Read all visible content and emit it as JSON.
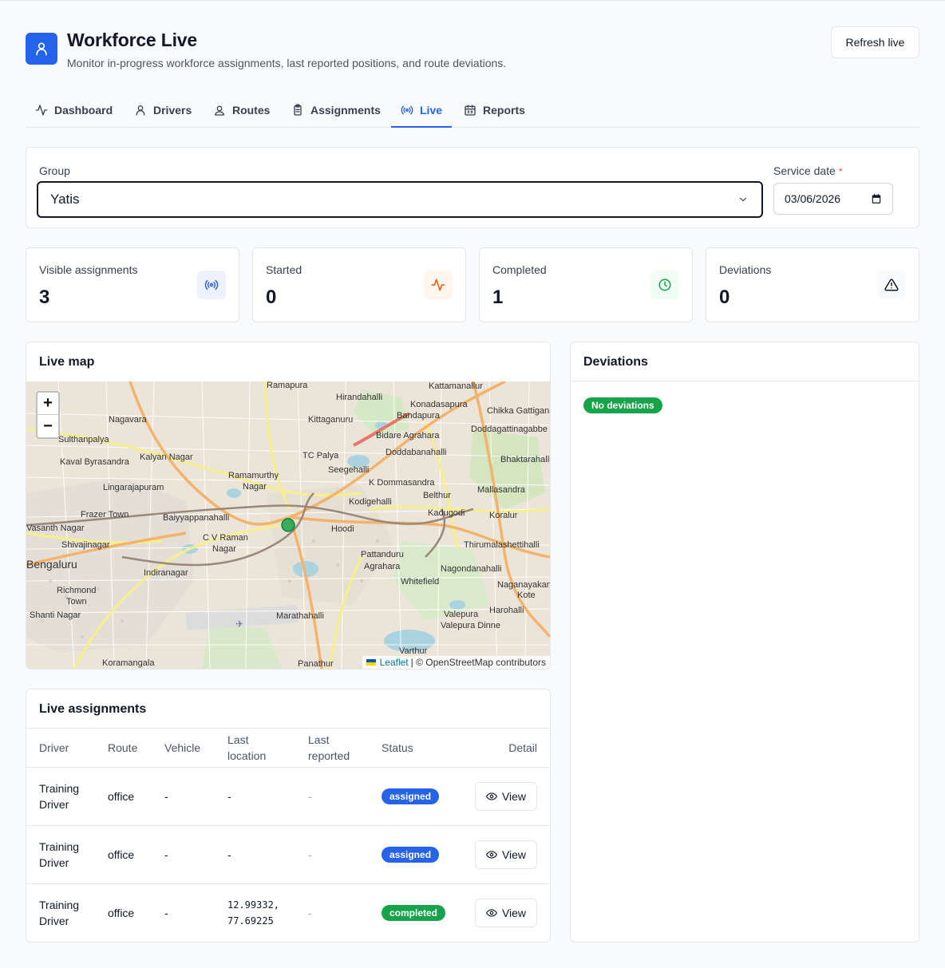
{
  "header": {
    "title": "Workforce Live",
    "subtitle": "Monitor in-progress workforce assignments, last reported positions, and route deviations.",
    "refresh_label": "Refresh live"
  },
  "tabs": [
    {
      "label": "Dashboard",
      "icon": "activity-icon"
    },
    {
      "label": "Drivers",
      "icon": "user-icon"
    },
    {
      "label": "Routes",
      "icon": "map-pin-user-icon"
    },
    {
      "label": "Assignments",
      "icon": "clipboard-icon"
    },
    {
      "label": "Live",
      "icon": "radio-icon",
      "active": true
    },
    {
      "label": "Reports",
      "icon": "calendar-icon"
    }
  ],
  "filters": {
    "group_label": "Group",
    "group_value": "Yatis",
    "date_label": "Service date",
    "date_required": "*",
    "date_value": "03/06/2026"
  },
  "stats": [
    {
      "label": "Visible assignments",
      "value": "3",
      "icon": "radio-icon",
      "color": "#2563eb",
      "bg": "#eef2ff"
    },
    {
      "label": "Started",
      "value": "0",
      "icon": "activity-icon",
      "color": "#ea580c",
      "bg": "#fff7ed"
    },
    {
      "label": "Completed",
      "value": "1",
      "icon": "clock-icon",
      "color": "#16a34a",
      "bg": "#f0fdf4"
    },
    {
      "label": "Deviations",
      "value": "0",
      "icon": "alert-triangle-icon",
      "color": "#111827",
      "bg": "#f9fafb"
    }
  ],
  "map": {
    "title": "Live map",
    "zoom_in": "+",
    "zoom_out": "−",
    "attribution_link": "Leaflet",
    "attribution_text": "| © OpenStreetMap contributors",
    "places": [
      "Ramapura",
      "Kattamanallur",
      "Hirandahalli",
      "Konadasapura",
      "Bandapura",
      "Chikka Gattigana",
      "Nagavara",
      "Kittaganuru",
      "Doddagattinagabbe",
      "Sulthanpalya",
      "Bidare Agrahara",
      "Kalyan Nagar",
      "Doddabanahalli",
      "Kaval Byrasandra",
      "TC Palya",
      "Bhaktarahalli",
      "Seegehalli",
      "Ramamurthy",
      "Nagar",
      "K Dommasandra",
      "Lingarajapuram",
      "Mallasandra",
      "Belthur",
      "Kodigehalli",
      "Frazer Town",
      "Kadugodi",
      "Baiyyappanahalli",
      "Koralur",
      "Hoodi",
      "Vasanth Nagar",
      "C V Raman",
      "Nagar",
      "Shivajinagar",
      "Thirumalashettihalli",
      "Pattanduru",
      "Agrahara",
      "Bengaluru",
      "Indiranagar",
      "Nagondanahalli",
      "Whitefield",
      "Richmond",
      "Town",
      "Naganayakana",
      "Kote",
      "Shanti Nagar",
      "Marathahalli",
      "Harohalli",
      "Valepura",
      "Valepura Dinne",
      "Varthur",
      "Koramangala",
      "Panathur"
    ]
  },
  "deviations": {
    "title": "Deviations",
    "empty_badge": "No deviations"
  },
  "assignments": {
    "title": "Live assignments",
    "columns": {
      "driver": "Driver",
      "route": "Route",
      "vehicle": "Vehicle",
      "last_location_1": "Last",
      "last_location_2": "location",
      "last_reported_1": "Last",
      "last_reported_2": "reported",
      "status": "Status",
      "detail": "Detail"
    },
    "rows": [
      {
        "driver_1": "Training",
        "driver_2": "Driver",
        "route": "office",
        "vehicle": "-",
        "location_1": "-",
        "location_2": "",
        "reported": "-",
        "status": "assigned",
        "action": "View"
      },
      {
        "driver_1": "Training",
        "driver_2": "Driver",
        "route": "office",
        "vehicle": "-",
        "location_1": "-",
        "location_2": "",
        "reported": "-",
        "status": "assigned",
        "action": "View"
      },
      {
        "driver_1": "Training",
        "driver_2": "Driver",
        "route": "office",
        "vehicle": "-",
        "location_1": "12.99332,",
        "location_2": "77.69225",
        "reported": "-",
        "status": "completed",
        "action": "View"
      }
    ]
  },
  "colors": {
    "accent": "#2563eb",
    "assigned": "#2563eb",
    "completed": "#16a34a",
    "map_marker": "#16a34a"
  }
}
